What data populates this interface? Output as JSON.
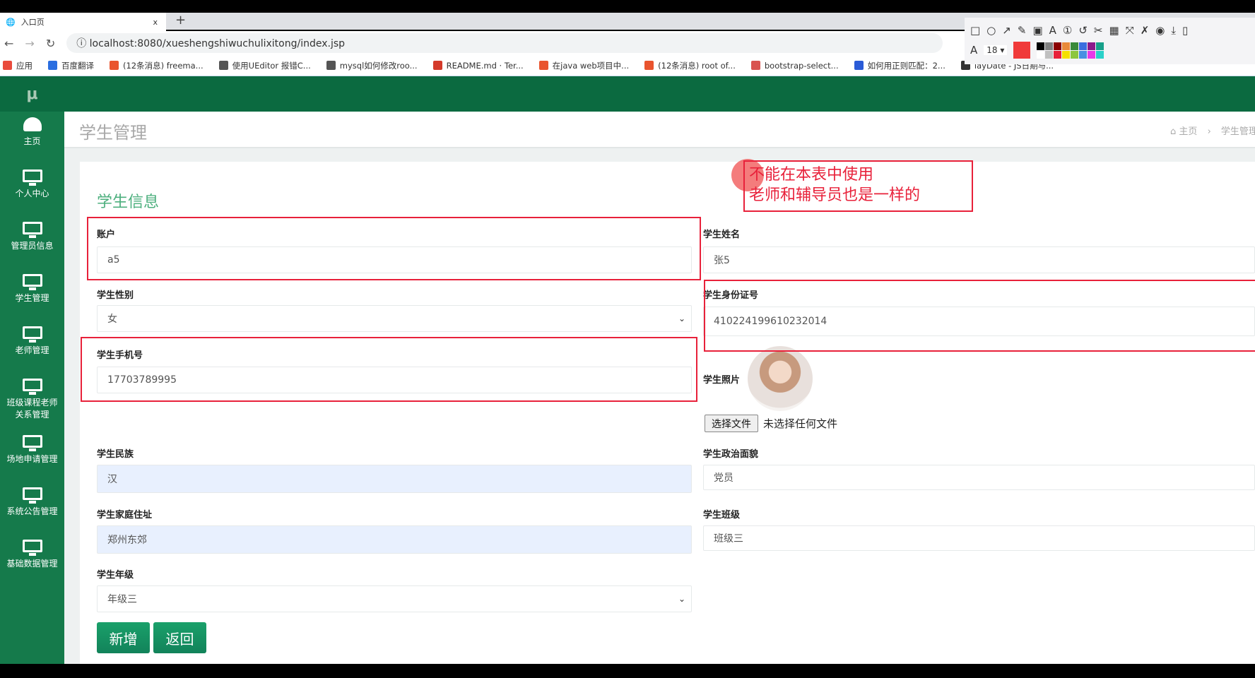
{
  "browser": {
    "tab_title": "入口页",
    "tab_close": "x",
    "new_tab": "+",
    "url": "localhost:8080/xueshengshiwuchulixitong/index.jsp",
    "bookmarks": [
      {
        "label": "应用",
        "color": "#e94b3c"
      },
      {
        "label": "百度翻译",
        "color": "#2a6ee0"
      },
      {
        "label": "(12条消息) freema...",
        "color": "#e9542e"
      },
      {
        "label": "使用UEditor 报错C...",
        "color": "#555555"
      },
      {
        "label": "mysql如何修改roo...",
        "color": "#555555"
      },
      {
        "label": "README.md · Ter...",
        "color": "#d43a2a"
      },
      {
        "label": "在java web项目中...",
        "color": "#e9542e"
      },
      {
        "label": "(12条消息) root of...",
        "color": "#e9542e"
      },
      {
        "label": "bootstrap-select...",
        "color": "#d9534f"
      },
      {
        "label": "如何用正则匹配：2...",
        "color": "#2a5bd7"
      },
      {
        "label": "layDate - JS日期与...",
        "color": "#333333"
      }
    ]
  },
  "annotation_toolbar": {
    "tools": [
      "□",
      "○",
      "↗",
      "✎",
      "▣",
      "A",
      "①",
      "↺",
      "✂",
      "▦",
      "⤧",
      "✗",
      "◉",
      "⤓",
      "▯"
    ],
    "font_label": "A",
    "font_size": "18",
    "current_color": "#f03a3a",
    "palette": [
      "#000000",
      "#808080",
      "#8b0000",
      "#e98a3a",
      "#3a8a3a",
      "#3a6ee0",
      "#8b1a8b",
      "#17a08a",
      "#ffffff",
      "#c0c0c0",
      "#e8213a",
      "#f5e000",
      "#8cc63f",
      "#4a90e2",
      "#e83ae8",
      "#2ad1c9"
    ]
  },
  "app": {
    "logo": "μ",
    "sidebar": [
      {
        "label": "主页",
        "icon": "dashboard-icon"
      },
      {
        "label": "个人中心",
        "icon": "monitor-icon"
      },
      {
        "label": "管理员信息",
        "icon": "monitor-icon"
      },
      {
        "label": "学生管理",
        "icon": "monitor-icon"
      },
      {
        "label": "老师管理",
        "icon": "monitor-icon"
      },
      {
        "label": "班级课程老师\n关系管理",
        "icon": "monitor-icon"
      },
      {
        "label": "场地申请管理",
        "icon": "monitor-icon"
      },
      {
        "label": "系统公告管理",
        "icon": "monitor-icon"
      },
      {
        "label": "基础数据管理",
        "icon": "monitor-icon"
      }
    ],
    "page_title": "学生管理",
    "breadcrumb": {
      "home": "主页",
      "separator": "›",
      "current": "学生管理"
    },
    "card_title": "学生信息",
    "form": {
      "account": {
        "label": "账户",
        "value": "a5"
      },
      "name": {
        "label": "学生姓名",
        "value": "张5"
      },
      "gender": {
        "label": "学生性别",
        "value": "女"
      },
      "id_card": {
        "label": "学生身份证号",
        "value": "410224199610232014"
      },
      "phone": {
        "label": "学生手机号",
        "value": "17703789995"
      },
      "photo": {
        "label": "学生照片",
        "choose_button": "选择文件",
        "file_status": "未选择任何文件"
      },
      "ethnicity": {
        "label": "学生民族",
        "value": "汉"
      },
      "politics": {
        "label": "学生政治面貌",
        "value": "党员"
      },
      "address": {
        "label": "学生家庭住址",
        "value": "郑州东郊"
      },
      "class": {
        "label": "学生班级",
        "value": "班级三"
      },
      "grade": {
        "label": "学生年级",
        "value": "年级三"
      }
    },
    "buttons": {
      "add": "新增",
      "back": "返回"
    },
    "colors": {
      "header": "#0b6a40",
      "sidebar": "#157a4b",
      "button": "#12835a",
      "title": "#4caf7d"
    }
  },
  "annotation": {
    "line1": "不能在本表中使用",
    "line2": "老师和辅导员也是一样的",
    "color": "#e8213a"
  }
}
